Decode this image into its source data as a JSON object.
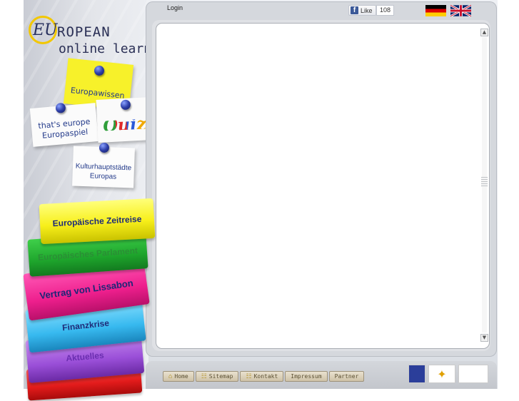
{
  "logo": {
    "mark": "EU",
    "line1": "ROPEAN",
    "line2": "online learning"
  },
  "notes": [
    {
      "label": "Europawissen"
    },
    {
      "label_line1": "that's europe",
      "label_line2": "Europaspiel"
    },
    {
      "label": "Quiz"
    },
    {
      "label_line1": "Kulturhauptstädte",
      "label_line2": "Europas"
    }
  ],
  "books": [
    {
      "label": "Europäische Zeitreise"
    },
    {
      "label": "Europäisches Parlament"
    },
    {
      "label": "Vertrag von Lissabon"
    },
    {
      "label": "Finanzkrise"
    },
    {
      "label": "Aktuelles"
    }
  ],
  "topbar": {
    "login": "Login",
    "like": "Like",
    "like_count": "108"
  },
  "flags": [
    {
      "name": "German"
    },
    {
      "name": "English"
    }
  ],
  "nav": [
    {
      "label": "Home"
    },
    {
      "label": "Sitemap"
    },
    {
      "label": "Kontakt"
    },
    {
      "label": "Impressum"
    },
    {
      "label": "Partner"
    }
  ],
  "colors": {
    "accent_yellow": "#f7ef1a",
    "book_green": "#1ea52c",
    "book_pink": "#ee1f8d",
    "book_blue": "#37b9ef",
    "book_purple": "#9a4fd8",
    "book_red": "#e21b1b"
  }
}
